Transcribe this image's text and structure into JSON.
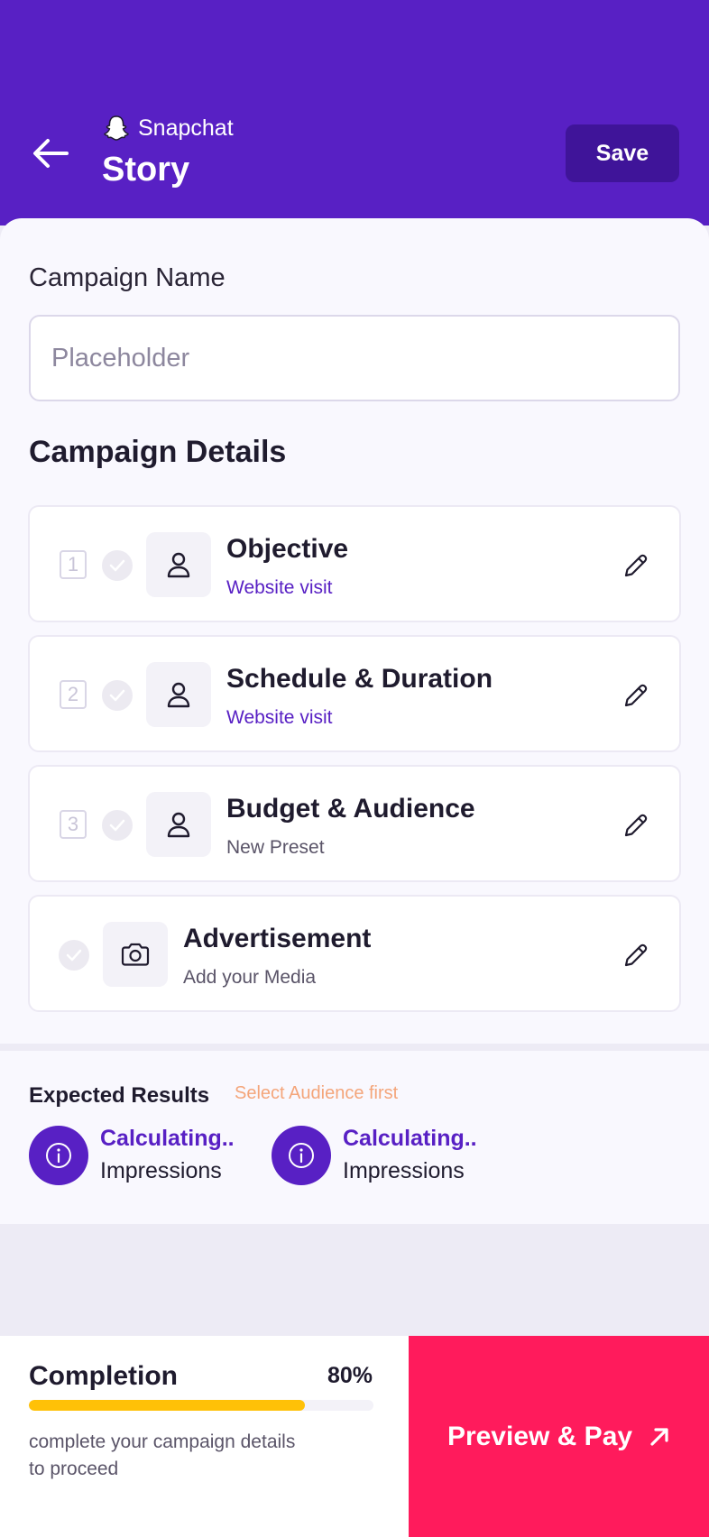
{
  "header": {
    "platform": "Snapchat",
    "title": "Story",
    "save_label": "Save"
  },
  "form": {
    "campaign_name_label": "Campaign Name",
    "campaign_name_placeholder": "Placeholder",
    "details_title": "Campaign Details"
  },
  "steps": [
    {
      "number": "1",
      "title": "Objective",
      "subtitle": "Website visit",
      "icon": "person-icon"
    },
    {
      "number": "2",
      "title": "Schedule & Duration",
      "subtitle": "Website visit",
      "icon": "person-icon"
    },
    {
      "number": "3",
      "title": "Budget & Audience",
      "subtitle": "New Preset",
      "icon": "person-icon"
    },
    {
      "title": "Advertisement",
      "subtitle": "Add your Media",
      "icon": "camera-icon"
    }
  ],
  "results": {
    "title": "Expected Results",
    "hint": "Select Audience first",
    "metrics": [
      {
        "value": "Calculating..",
        "label": "Impressions"
      },
      {
        "value": "Calculating..",
        "label": "Impressions"
      }
    ]
  },
  "footer": {
    "completion_label": "Completion",
    "completion_percent": "80%",
    "completion_progress": 0.8,
    "helper_text": "complete your campaign details to proceed",
    "cta_label": "Preview & Pay"
  },
  "colors": {
    "primary": "#5820C4",
    "primary_dark": "#3F1499",
    "cta": "#FF1B5C",
    "progress": "#FFC107",
    "hint": "#F4A57A"
  }
}
